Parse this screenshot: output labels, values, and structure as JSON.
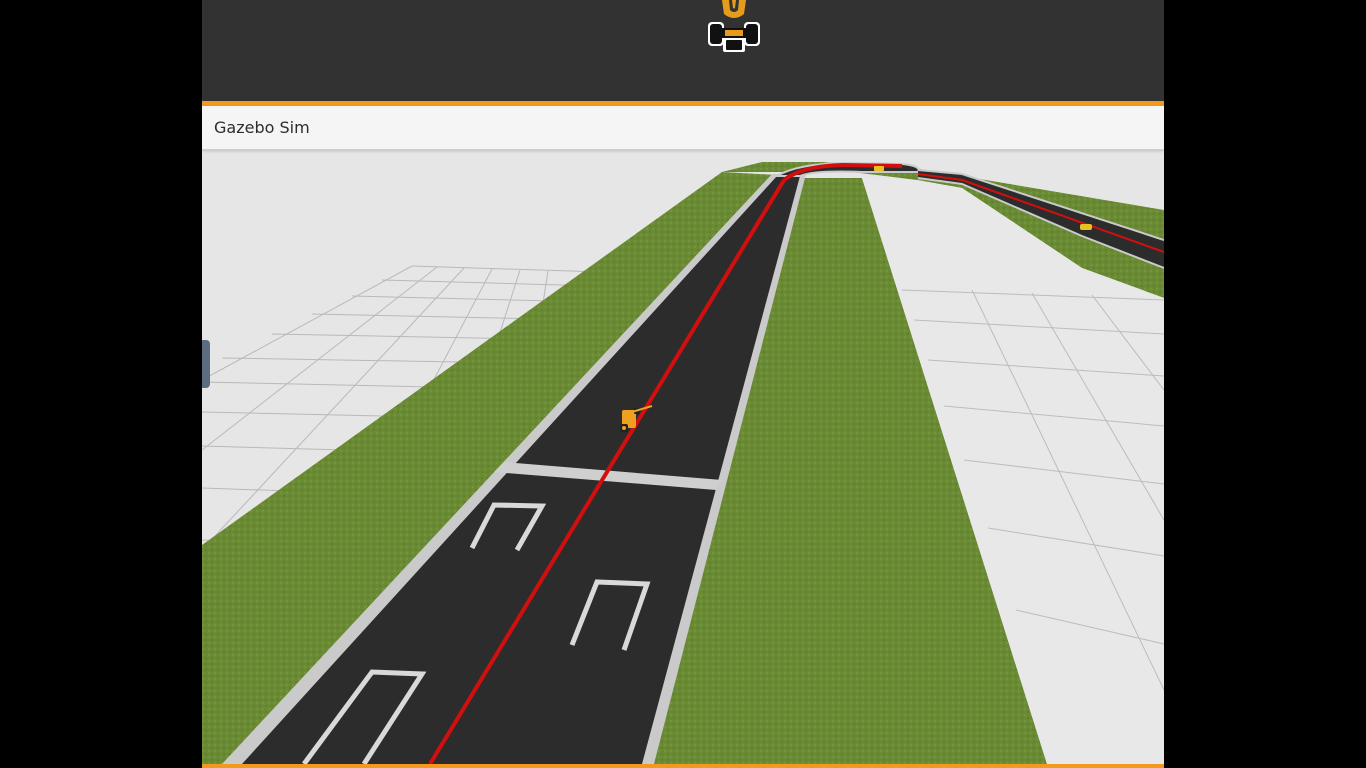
{
  "window": {
    "title": "Gazebo Sim"
  },
  "header": {
    "logo": "racecar-logo-icon",
    "accent_color": "#f39a1e",
    "background_color": "#333232"
  },
  "scene": {
    "type": "3d-race-track-view",
    "colors": {
      "ground": "#e6e6e6",
      "grass": "#6b8c35",
      "asphalt": "#2b2b2b",
      "track_border": "#c8c8c8",
      "racing_line": "#d20f0f",
      "car": "#f0a020"
    },
    "grid": true
  }
}
